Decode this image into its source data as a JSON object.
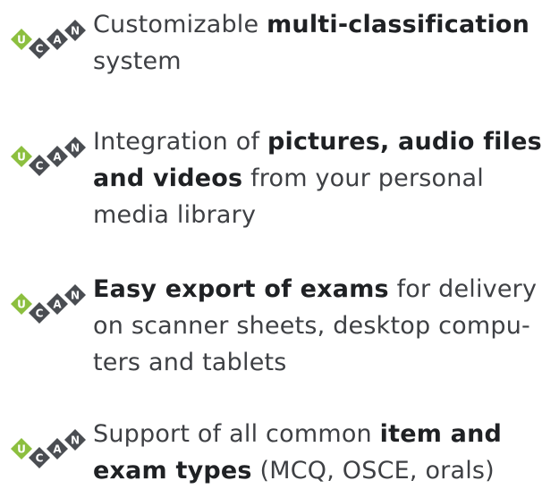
{
  "brand": {
    "logo_letters": [
      "U",
      "C",
      "A",
      "N"
    ],
    "colors": {
      "green": "#8cbf3f",
      "dark": "#4a4d52",
      "text": "#3e4044",
      "bold_text": "#1f2124"
    }
  },
  "features": [
    {
      "icon": "ucan-logo-icon",
      "lines": [
        [
          {
            "text": "Customizable ",
            "bold": false
          },
          {
            "text": "multi-classification",
            "bold": true
          }
        ],
        [
          {
            "text": "system",
            "bold": false
          }
        ]
      ]
    },
    {
      "icon": "ucan-logo-icon",
      "lines": [
        [
          {
            "text": "Integration of ",
            "bold": false
          },
          {
            "text": "pictures, audio files",
            "bold": true
          }
        ],
        [
          {
            "text": "and videos",
            "bold": true
          },
          {
            "text": " from your personal",
            "bold": false
          }
        ],
        [
          {
            "text": "media library",
            "bold": false
          }
        ]
      ]
    },
    {
      "icon": "ucan-logo-icon",
      "lines": [
        [
          {
            "text": "Easy export of exams",
            "bold": true
          },
          {
            "text": " for delivery",
            "bold": false
          }
        ],
        [
          {
            "text": "on scanner sheets, desktop compu-",
            "bold": false
          }
        ],
        [
          {
            "text": "ters and tablets",
            "bold": false
          }
        ]
      ]
    },
    {
      "icon": "ucan-logo-icon",
      "lines": [
        [
          {
            "text": "Support of all common ",
            "bold": false
          },
          {
            "text": "item and",
            "bold": true
          }
        ],
        [
          {
            "text": "exam types",
            "bold": true
          },
          {
            "text": " (MCQ, OSCE, orals)",
            "bold": false
          }
        ]
      ]
    }
  ]
}
